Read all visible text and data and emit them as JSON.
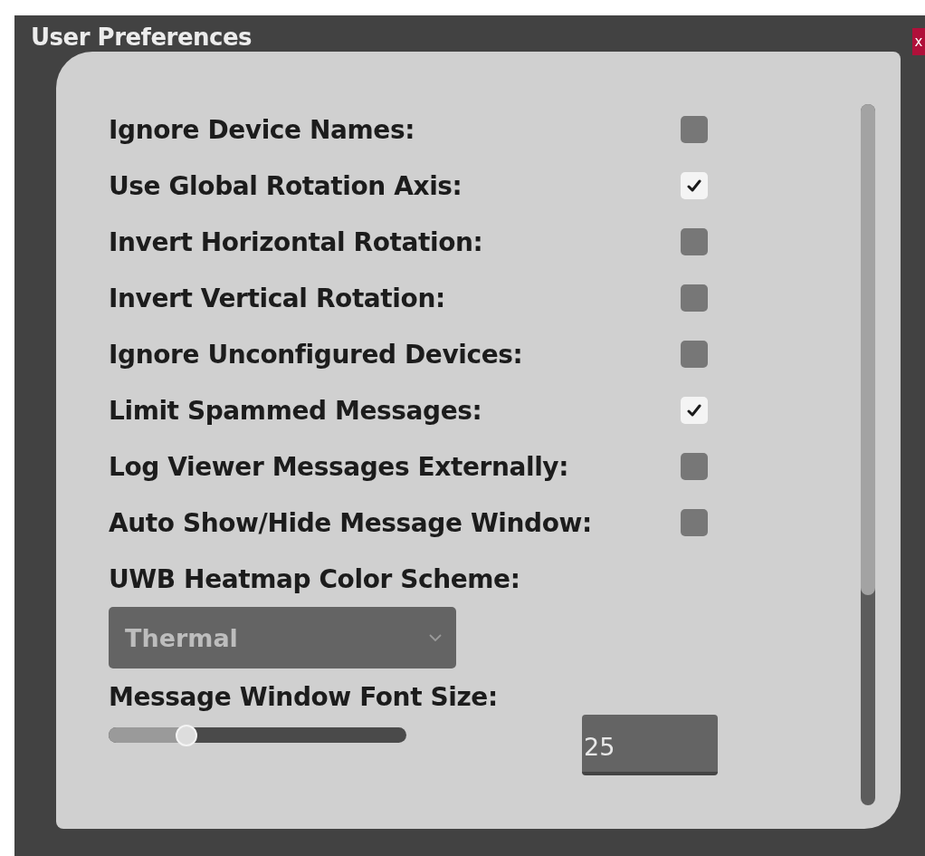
{
  "window": {
    "title": "User Preferences",
    "close": "x"
  },
  "options": [
    {
      "label": "Ignore Device Names:",
      "checked": false
    },
    {
      "label": "Use Global Rotation Axis:",
      "checked": true
    },
    {
      "label": "Invert Horizontal Rotation:",
      "checked": false
    },
    {
      "label": "Invert Vertical Rotation:",
      "checked": false
    },
    {
      "label": "Ignore Unconfigured Devices:",
      "checked": false
    },
    {
      "label": "Limit Spammed Messages:",
      "checked": true
    },
    {
      "label": "Log Viewer Messages Externally:",
      "checked": false
    },
    {
      "label": "Auto Show/Hide Message Window:",
      "checked": false
    }
  ],
  "color_scheme": {
    "label": "UWB Heatmap Color Scheme:",
    "value": "Thermal"
  },
  "font_size": {
    "label": "Message Window Font Size:",
    "level": 0.26,
    "value": "25"
  }
}
